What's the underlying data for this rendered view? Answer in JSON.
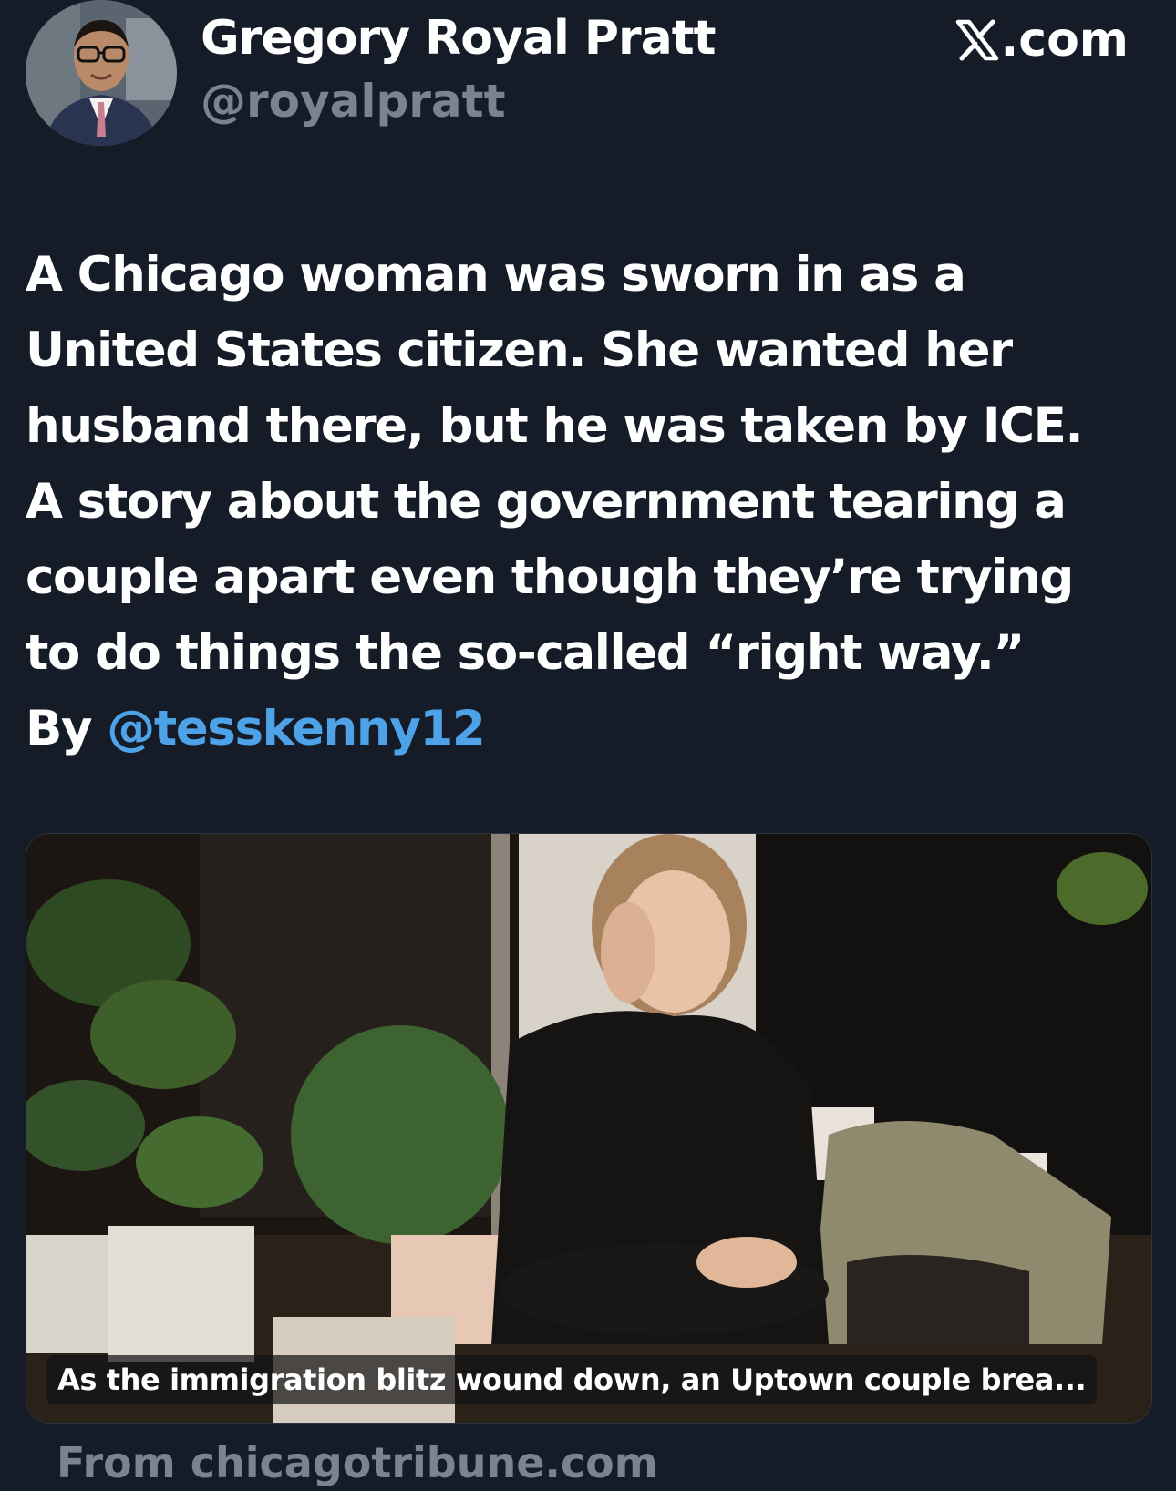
{
  "author": {
    "display_name": "Gregory Royal Pratt",
    "handle": "@royalpratt"
  },
  "site": {
    "label": ".com",
    "icon": "x-logo-icon"
  },
  "tweet": {
    "lines": [
      "A Chicago woman was sworn in as a",
      "United States citizen. She wanted her",
      "husband there, but he was taken by ICE.",
      "A story about the government tearing a",
      "couple apart even though they’re trying",
      "to do things the so-called “right way.”"
    ],
    "byline_prefix": "By",
    "byline_mention": "@tesskenny12"
  },
  "card": {
    "caption": "As the immigration blitz wound down, an Uptown couple brea...",
    "source": "From chicagotribune.com"
  },
  "colors": {
    "background": "#151c28",
    "text": "#ffffff",
    "muted": "#7a8491",
    "mention": "#4ea3e8"
  }
}
